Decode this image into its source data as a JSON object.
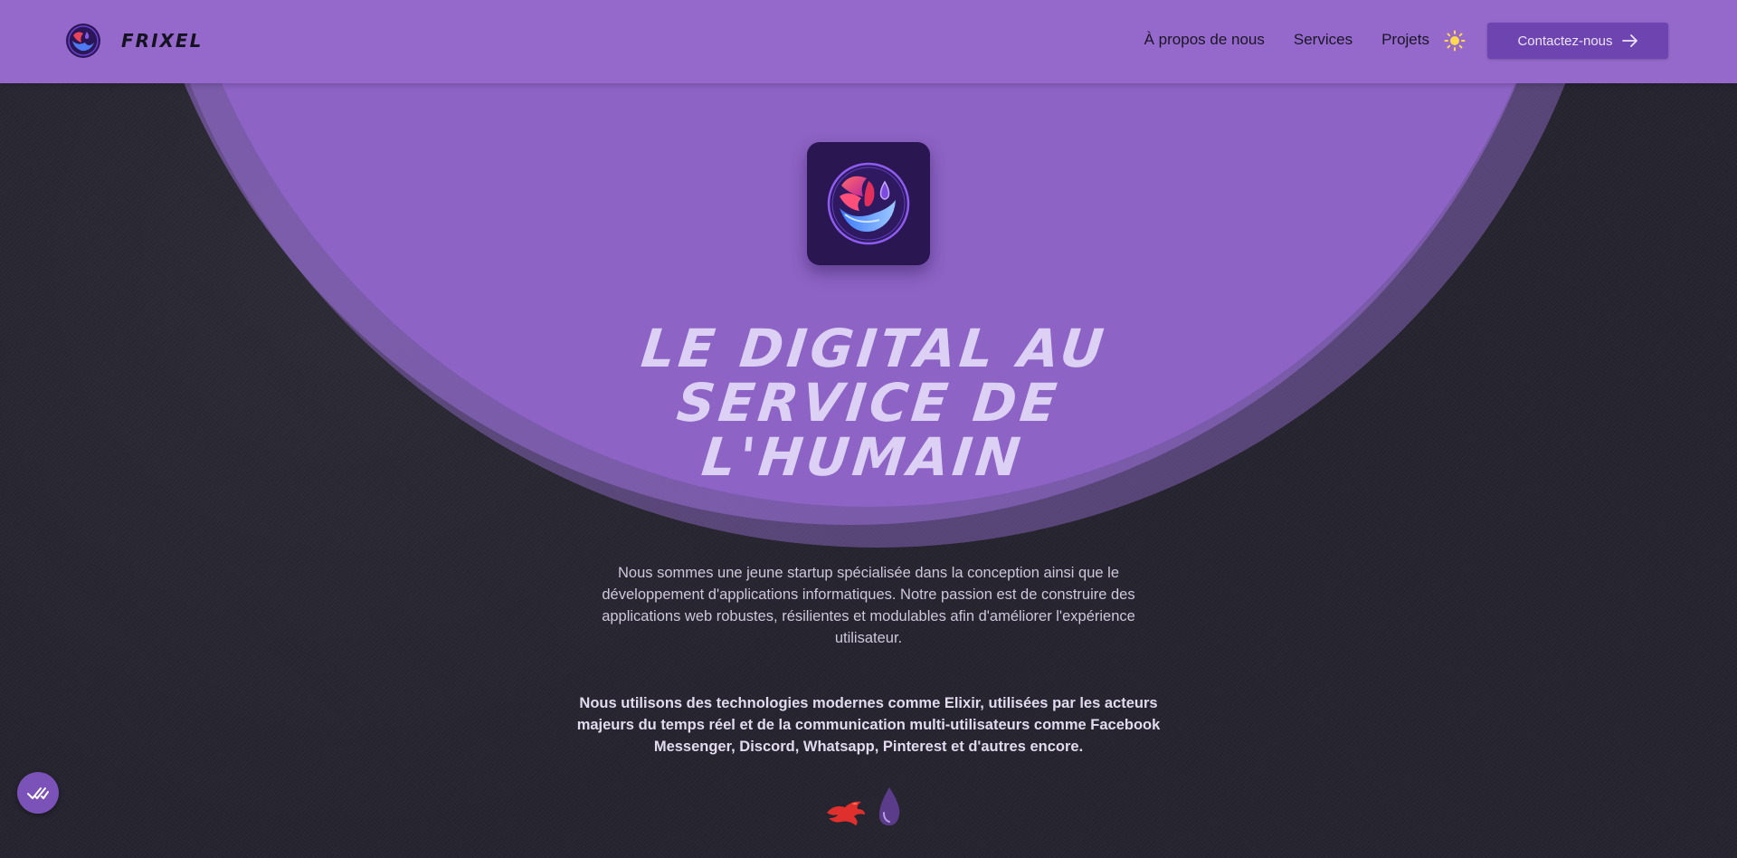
{
  "header": {
    "brand_name": "FRIXEL",
    "nav": [
      {
        "label": "À propos de nous"
      },
      {
        "label": "Services"
      },
      {
        "label": "Projets"
      }
    ],
    "theme_icon": "sun-icon",
    "cta_label": "Contactez-nous"
  },
  "hero": {
    "logo_icon": "phoenix-logo-icon",
    "title_lines": [
      "LE DIGITAL AU",
      "SERVICE DE",
      "L'HUMAIN"
    ],
    "intro": "Nous sommes une jeune startup spécialisée dans la conception ainsi que le développement d'applications informatiques. Notre passion est de construire des applications web robustes, résilientes et modulables afin d'améliorer l'expérience utilisateur.",
    "tech": "Nous utilisons des technologies modernes comme Elixir, utilisées par les acteurs majeurs du temps réel et de la communication multi-utilisateurs comme Facebook Messenger, Discord, Whatsapp, Pinterest et d'autres encore.",
    "tech_icons": [
      "phoenix-framework-icon",
      "elixir-drop-icon"
    ]
  },
  "fab": {
    "icon": "checkmarks-icon"
  },
  "colors": {
    "header_bg": "#9569cb",
    "page_bg": "#26242f",
    "arc": "#8f64c8",
    "cta_bg": "#6e45b0",
    "title": "#dcd0f4"
  }
}
